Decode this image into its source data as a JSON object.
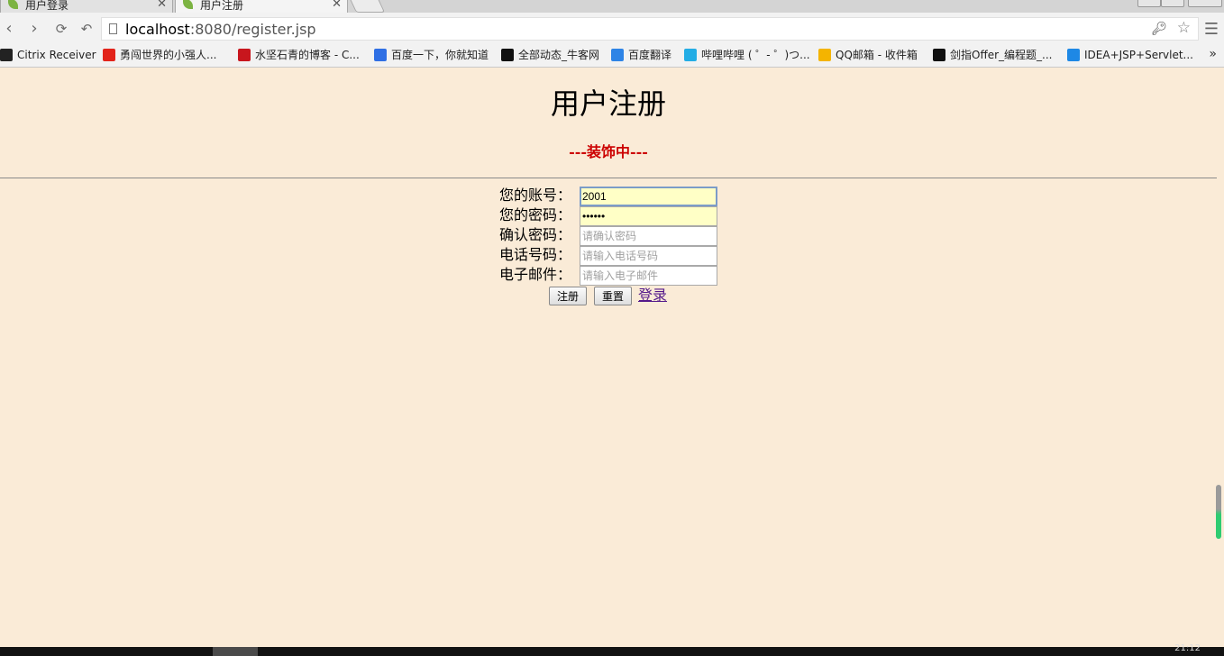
{
  "browser": {
    "tabs": [
      {
        "label": "用户登录",
        "active": false
      },
      {
        "label": "用户注册",
        "active": true
      }
    ],
    "url_host": "localhost",
    "url_rest": ":8080/register.jsp",
    "bookmarks": [
      {
        "label": "Citrix Receiver",
        "icon_color": "#222222"
      },
      {
        "label": "勇闯世界的小强人...",
        "icon_color": "#e2231a"
      },
      {
        "label": "水坚石青的博客 - C...",
        "icon_color": "#c8161d"
      },
      {
        "label": "百度一下，你就知道",
        "icon_color": "#2f6fe4"
      },
      {
        "label": "全部动态_牛客网",
        "icon_color": "#111111"
      },
      {
        "label": "百度翻译",
        "icon_color": "#2e84e6"
      },
      {
        "label": "哔哩哔哩 ( ゜- ゜)つ...",
        "icon_color": "#23ade5"
      },
      {
        "label": "QQ邮箱 - 收件箱",
        "icon_color": "#f4b400"
      },
      {
        "label": "剑指Offer_编程题_...",
        "icon_color": "#111111"
      },
      {
        "label": "IDEA+JSP+Servlet...",
        "icon_color": "#1e88e5"
      }
    ],
    "bookmarks_more": "»",
    "clock": "21:12"
  },
  "page": {
    "title": "用户注册",
    "subtitle": "---装饰中---",
    "background": "#faebd7",
    "form": {
      "account_label": "您的账号：",
      "account_value": "2001",
      "password_label": "您的密码：",
      "password_value": "••••••",
      "confirm_label": "确认密码：",
      "confirm_placeholder": "请确认密码",
      "phone_label": "电话号码：",
      "phone_placeholder": "请输入电话号码",
      "email_label": "电子邮件：",
      "email_placeholder": "请输入电子邮件",
      "submit_label": "注册",
      "reset_label": "重置",
      "login_link": "登录"
    }
  }
}
